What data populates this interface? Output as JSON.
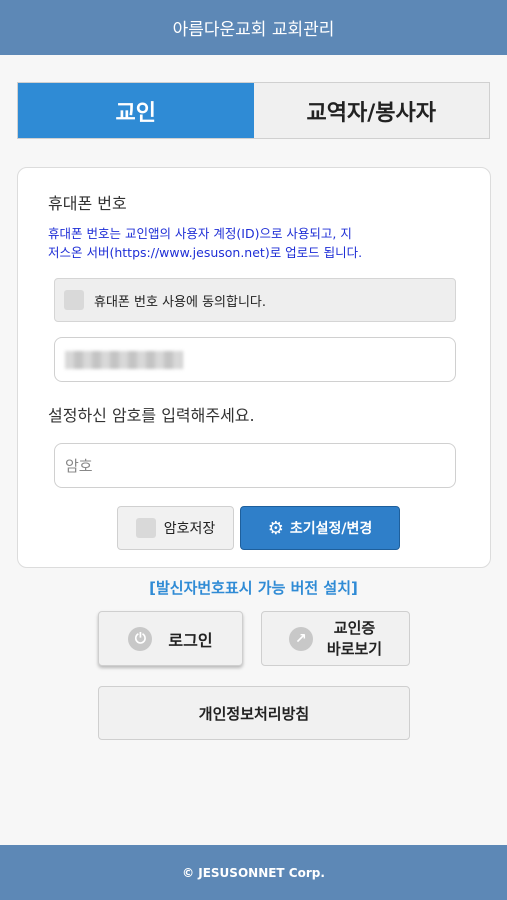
{
  "header": {
    "title": "아름다운교회 교회관리"
  },
  "tabs": [
    {
      "label": "교인",
      "active": true
    },
    {
      "label": "교역자/봉사자",
      "active": false
    }
  ],
  "form": {
    "phone_label": "휴대폰 번호",
    "notice_line1": "휴대폰 번호는 교인앱의 사용자 계정(ID)으로 사용되고, 지",
    "notice_line2": "저스온 서버(https://www.jesuson.net)로 업로드 됩니다.",
    "consent_label": "휴대폰 번호 사용에 동의합니다.",
    "password_label": "설정하신 암호를 입력해주세요.",
    "password_placeholder": "암호",
    "save_password_label": "암호저장",
    "reset_button_label": "초기설정/변경"
  },
  "install_link": "[발신자번호표시 가능 버전 설치]",
  "buttons": {
    "login": "로그인",
    "member_card_line1": "교인증",
    "member_card_line2": "바로보기",
    "privacy": "개인정보처리방침"
  },
  "footer": {
    "text": "© JESUSONNET Corp."
  },
  "colors": {
    "header_bg": "#5d88b6",
    "tab_active": "#2f8bd5",
    "notice_text": "#1f2fd6",
    "primary_button": "#2f7fc9",
    "link": "#2f8bd5"
  }
}
